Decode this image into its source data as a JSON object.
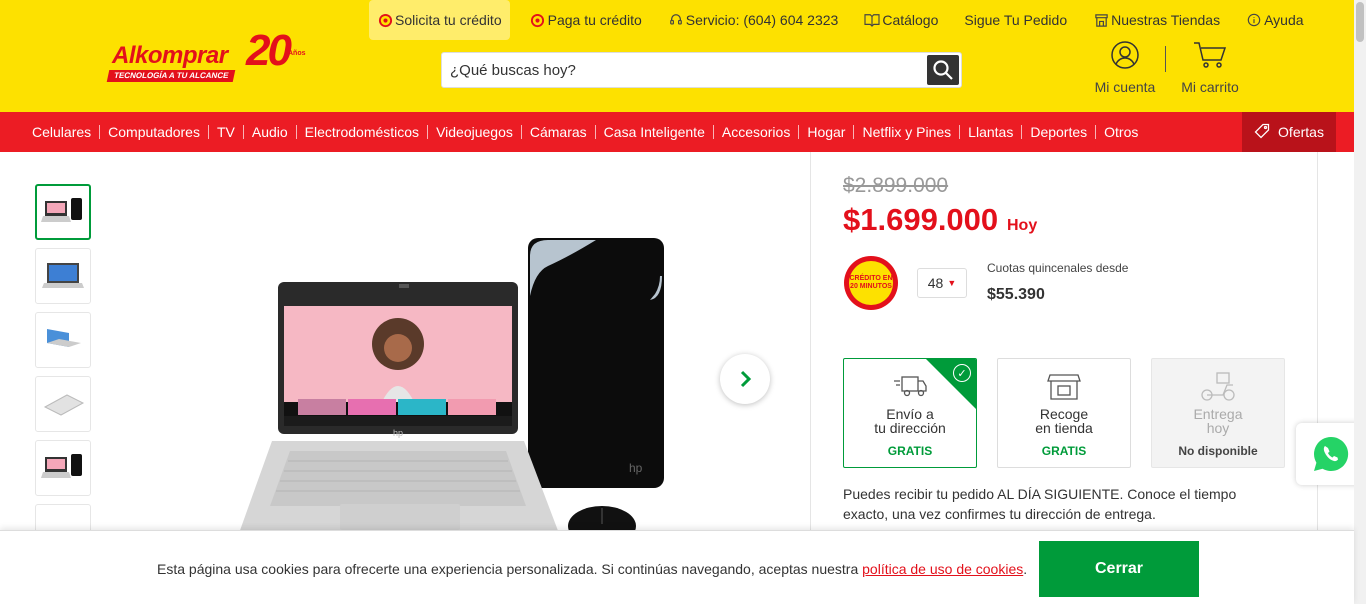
{
  "brand": {
    "name": "Alkomprar",
    "tagline": "TECNOLOGÍA A TU ALCANCE",
    "anniversary": "20",
    "anniversary_label": "Años"
  },
  "toplinks": [
    {
      "label": "Solicita tu crédito",
      "icon": "credit-badge-icon"
    },
    {
      "label": "Paga tu crédito",
      "icon": "pay-badge-icon"
    },
    {
      "label": "Servicio: (604) 604 2323",
      "icon": "headset-icon"
    },
    {
      "label": "Catálogo",
      "icon": "catalog-icon"
    },
    {
      "label": "Sigue Tu Pedido",
      "icon": ""
    },
    {
      "label": "Nuestras Tiendas",
      "icon": "store-icon"
    },
    {
      "label": "Ayuda",
      "icon": "info-icon"
    }
  ],
  "search": {
    "placeholder": "¿Qué buscas hoy?"
  },
  "account": {
    "label": "Mi cuenta"
  },
  "cart": {
    "label": "Mi carrito"
  },
  "nav": [
    "Celulares",
    "Computadores",
    "TV",
    "Audio",
    "Electrodomésticos",
    "Videojuegos",
    "Cámaras",
    "Casa Inteligente",
    "Accesorios",
    "Hogar",
    "Netflix y Pines",
    "Llantas",
    "Deportes",
    "Otros"
  ],
  "nav_offer": "Ofertas",
  "product": {
    "old_price": "$2.899.000",
    "price": "$1.699.000",
    "price_suffix": "Hoy",
    "credit_badge": "CRÉDITO EN 20 MINUTOS",
    "installments": "48",
    "installments_label": "Cuotas quincenales desde",
    "installment_value": "$55.390",
    "screen_brand": "hp"
  },
  "shipping": [
    {
      "title1": "Envío a",
      "title2": "tu dirección",
      "sub": "GRATIS",
      "state": "selected"
    },
    {
      "title1": "Recoge",
      "title2": "en tienda",
      "sub": "GRATIS",
      "state": "normal"
    },
    {
      "title1": "Entrega",
      "title2": "hoy",
      "sub": "No disponible",
      "state": "disabled"
    }
  ],
  "delivery_text": "Puedes recibir tu pedido AL DÍA SIGUIENTE. Conoce el tiempo exacto, una vez confirmes tu dirección de entrega.",
  "cookie": {
    "text": "Esta página usa cookies para ofrecerte una experiencia personalizada. Si continúas navegando, aceptas nuestra ",
    "link": "política de uso de cookies",
    "end": ".",
    "button": "Cerrar"
  },
  "colors": {
    "yellow": "#fde100",
    "red": "#ec1c24",
    "green": "#009b3a",
    "price_red": "#e3101b"
  }
}
